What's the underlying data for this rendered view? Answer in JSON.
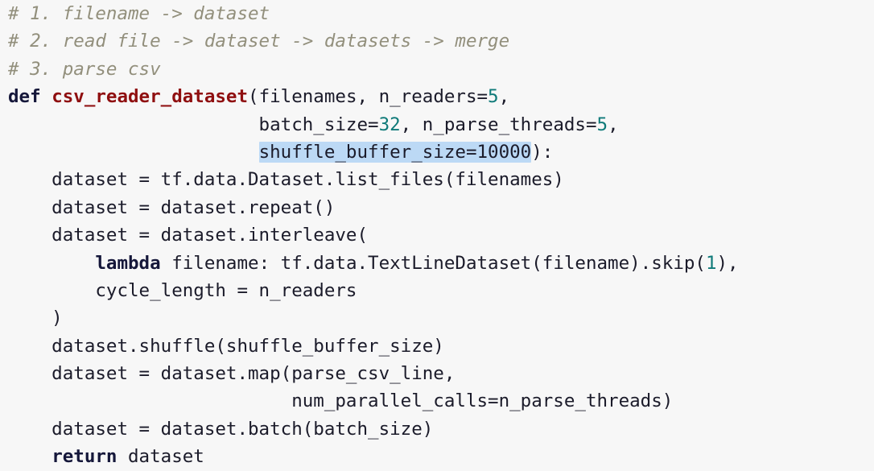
{
  "editor": {
    "background_color": "#f7f7f7",
    "font_size_px": 22.5,
    "line_height_px": 34.4,
    "selection_color": "#bcd9f5",
    "colors": {
      "comment": "#928f7c",
      "keyword": "#15173a",
      "function_name": "#8f0f10",
      "number": "#0f7a79",
      "plain_text": "#1b1b2a"
    }
  },
  "code": {
    "language": "python",
    "lines": [
      {
        "id": "line-1",
        "tokens": [
          {
            "kind": "comment",
            "text": "# 1. filename -> dataset"
          }
        ]
      },
      {
        "id": "line-2",
        "tokens": [
          {
            "kind": "comment",
            "text": "# 2. read file -> dataset -> datasets -> merge"
          }
        ]
      },
      {
        "id": "line-3",
        "tokens": [
          {
            "kind": "comment",
            "text": "# 3. parse csv"
          }
        ]
      },
      {
        "id": "line-4",
        "tokens": [
          {
            "kind": "keyword",
            "text": "def"
          },
          {
            "kind": "plain",
            "text": " "
          },
          {
            "kind": "funcname",
            "text": "csv_reader_dataset"
          },
          {
            "kind": "plain",
            "text": "(filenames, n_readers="
          },
          {
            "kind": "number",
            "text": "5"
          },
          {
            "kind": "plain",
            "text": ","
          }
        ]
      },
      {
        "id": "line-5",
        "tokens": [
          {
            "kind": "plain",
            "text": "                       batch_size="
          },
          {
            "kind": "number",
            "text": "32"
          },
          {
            "kind": "plain",
            "text": ", n_parse_threads="
          },
          {
            "kind": "number",
            "text": "5"
          },
          {
            "kind": "plain",
            "text": ","
          }
        ]
      },
      {
        "id": "line-6",
        "tokens": [
          {
            "kind": "plain",
            "text": "                       "
          },
          {
            "kind": "selection",
            "text": "shuffle_buffer_size=10000"
          },
          {
            "kind": "plain",
            "text": "):"
          }
        ]
      },
      {
        "id": "line-7",
        "tokens": [
          {
            "kind": "plain",
            "text": "    dataset = tf.data.Dataset.list_files(filenames)"
          }
        ]
      },
      {
        "id": "line-8",
        "tokens": [
          {
            "kind": "plain",
            "text": "    dataset = dataset.repeat()"
          }
        ]
      },
      {
        "id": "line-9",
        "tokens": [
          {
            "kind": "plain",
            "text": "    dataset = dataset.interleave("
          }
        ]
      },
      {
        "id": "line-10",
        "tokens": [
          {
            "kind": "plain",
            "text": "        "
          },
          {
            "kind": "keyword",
            "text": "lambda"
          },
          {
            "kind": "plain",
            "text": " filename: tf.data.TextLineDataset(filename).skip("
          },
          {
            "kind": "number",
            "text": "1"
          },
          {
            "kind": "plain",
            "text": "),"
          }
        ]
      },
      {
        "id": "line-11",
        "tokens": [
          {
            "kind": "plain",
            "text": "        cycle_length = n_readers"
          }
        ]
      },
      {
        "id": "line-12",
        "tokens": [
          {
            "kind": "plain",
            "text": "    )"
          }
        ]
      },
      {
        "id": "line-13",
        "tokens": [
          {
            "kind": "plain",
            "text": "    dataset.shuffle(shuffle_buffer_size)"
          }
        ]
      },
      {
        "id": "line-14",
        "tokens": [
          {
            "kind": "plain",
            "text": "    dataset = dataset.map(parse_csv_line,"
          }
        ]
      },
      {
        "id": "line-15",
        "tokens": [
          {
            "kind": "plain",
            "text": "                          num_parallel_calls=n_parse_threads)"
          }
        ]
      },
      {
        "id": "line-16",
        "tokens": [
          {
            "kind": "plain",
            "text": "    dataset = dataset.batch(batch_size)"
          }
        ]
      },
      {
        "id": "line-17",
        "tokens": [
          {
            "kind": "plain",
            "text": "    "
          },
          {
            "kind": "keyword",
            "text": "return"
          },
          {
            "kind": "plain",
            "text": " dataset"
          }
        ]
      }
    ]
  }
}
